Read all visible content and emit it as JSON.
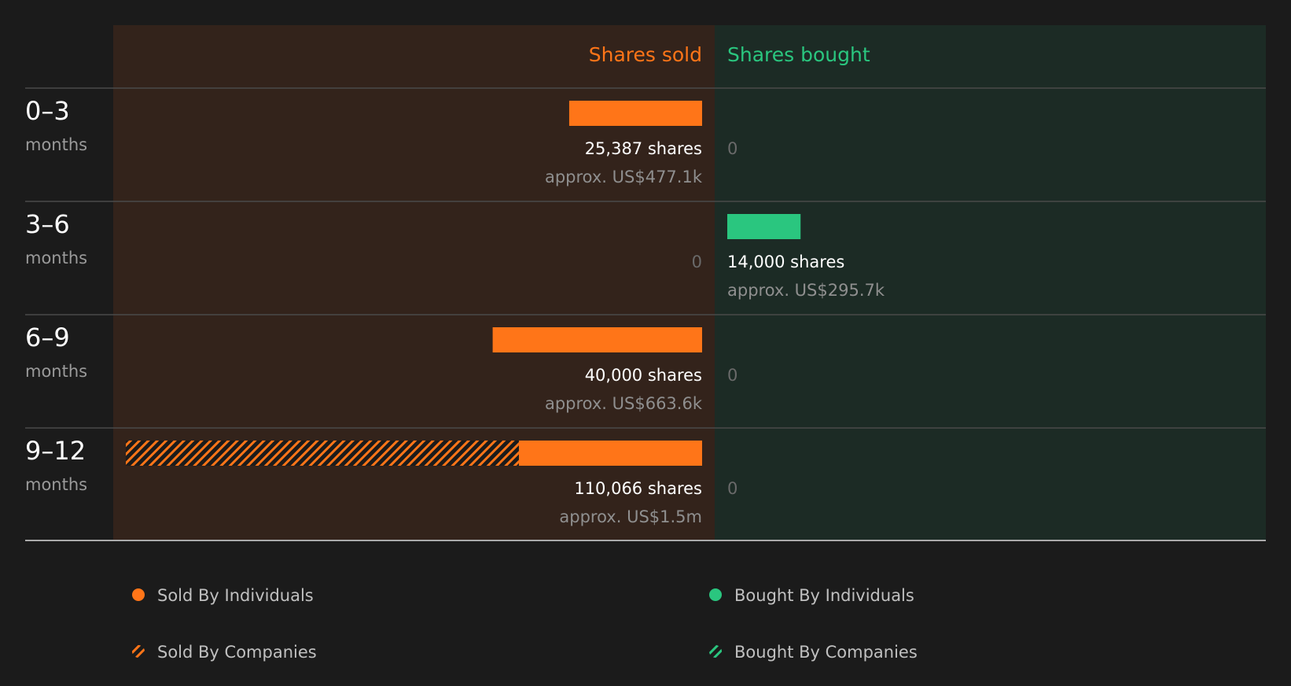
{
  "chart_data": {
    "type": "bar",
    "orientation": "horizontal-diverging",
    "columns": {
      "sold": "Shares sold",
      "bought": "Shares bought"
    },
    "rows": [
      {
        "period": "0–3",
        "unit": "months",
        "sold": {
          "individuals": 25387,
          "companies": 0,
          "label": "25,387 shares",
          "approx": "approx. US$477.1k",
          "zero_label": "0"
        },
        "bought": {
          "individuals": 0,
          "companies": 0,
          "label": "",
          "approx": "",
          "zero_label": "0"
        }
      },
      {
        "period": "3–6",
        "unit": "months",
        "sold": {
          "individuals": 0,
          "companies": 0,
          "label": "",
          "approx": "",
          "zero_label": "0"
        },
        "bought": {
          "individuals": 14000,
          "companies": 0,
          "label": "14,000 shares",
          "approx": "approx. US$295.7k",
          "zero_label": "0"
        }
      },
      {
        "period": "6–9",
        "unit": "months",
        "sold": {
          "individuals": 40000,
          "companies": 0,
          "label": "40,000 shares",
          "approx": "approx. US$663.6k",
          "zero_label": "0"
        },
        "bought": {
          "individuals": 0,
          "companies": 0,
          "label": "",
          "approx": "",
          "zero_label": "0"
        }
      },
      {
        "period": "9–12",
        "unit": "months",
        "sold": {
          "individuals": 35000,
          "companies": 75066,
          "label": "110,066 shares",
          "approx": "approx. US$1.5m",
          "zero_label": "0"
        },
        "bought": {
          "individuals": 0,
          "companies": 0,
          "label": "",
          "approx": "",
          "zero_label": "0"
        }
      }
    ],
    "max_shares": 110066,
    "legend": [
      {
        "label": "Sold By Individuals",
        "color": "#ff7518",
        "style": "solid"
      },
      {
        "label": "Sold By Companies",
        "color": "#ff7518",
        "style": "hatched"
      },
      {
        "label": "Bought By Individuals",
        "color": "#2ac67f",
        "style": "solid"
      },
      {
        "label": "Bought By Companies",
        "color": "#2ac67f",
        "style": "hatched"
      }
    ],
    "colors": {
      "sold": "#ff7518",
      "bought": "#2ac67f",
      "sold_panel": "#33231b",
      "bought_panel": "#1c2b25",
      "background": "#1b1b1b"
    }
  }
}
